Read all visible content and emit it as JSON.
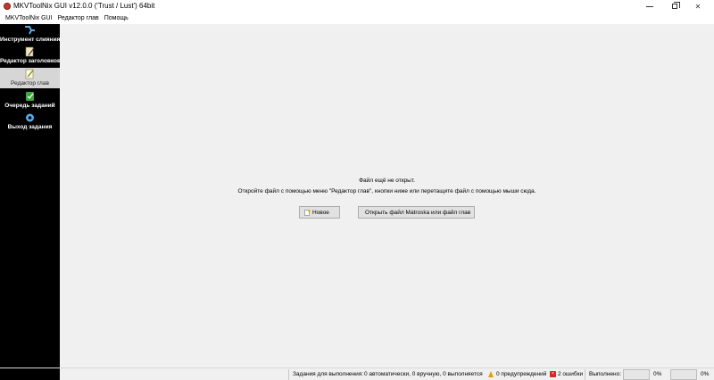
{
  "window": {
    "title": "MKVToolNix GUI v12.0.0 ('Trust / Lust') 64bit"
  },
  "menu": [
    {
      "label": "MKVToolNix GUI"
    },
    {
      "label": "Редактор глав"
    },
    {
      "label": "Помощь"
    }
  ],
  "sidebar": {
    "items": [
      {
        "label": "Инструмент слияния",
        "icon": "merge-tool-icon",
        "active": false
      },
      {
        "label": "Редактор заголовков",
        "icon": "header-editor-icon",
        "active": false
      },
      {
        "label": "Редактор глав",
        "icon": "chapter-editor-icon",
        "active": true
      },
      {
        "label": "Очередь заданий",
        "icon": "job-queue-icon",
        "active": false
      },
      {
        "label": "Выход задания",
        "icon": "job-output-icon",
        "active": false
      }
    ]
  },
  "main": {
    "message_line1": "Файл ещё не открыт.",
    "message_line2": "Откройте файл с помощью меню \"Редактор глав\", кнопки ниже или перетащите файл с помощью мыши сюда.",
    "new_button": "Новое",
    "open_button": "Открыть файл Matroska или файл глав"
  },
  "statusbar": {
    "jobs_label": "Задания для выполнения:",
    "jobs_value": "0 автоматически, 0 вручную, 0 выполняется",
    "warnings": "0 предупреждений",
    "errors": "2 ошибки",
    "progress_label": "Выполнено:",
    "progress_current": "0%",
    "progress_total": "0%",
    "progress_current_value": 0,
    "progress_total_value": 0
  },
  "colors": {
    "sidebar_bg": "#000000",
    "sidebar_active_bg": "#d6d6d6",
    "content_bg": "#f0f0f0",
    "button_bg": "#e1e1e1"
  }
}
